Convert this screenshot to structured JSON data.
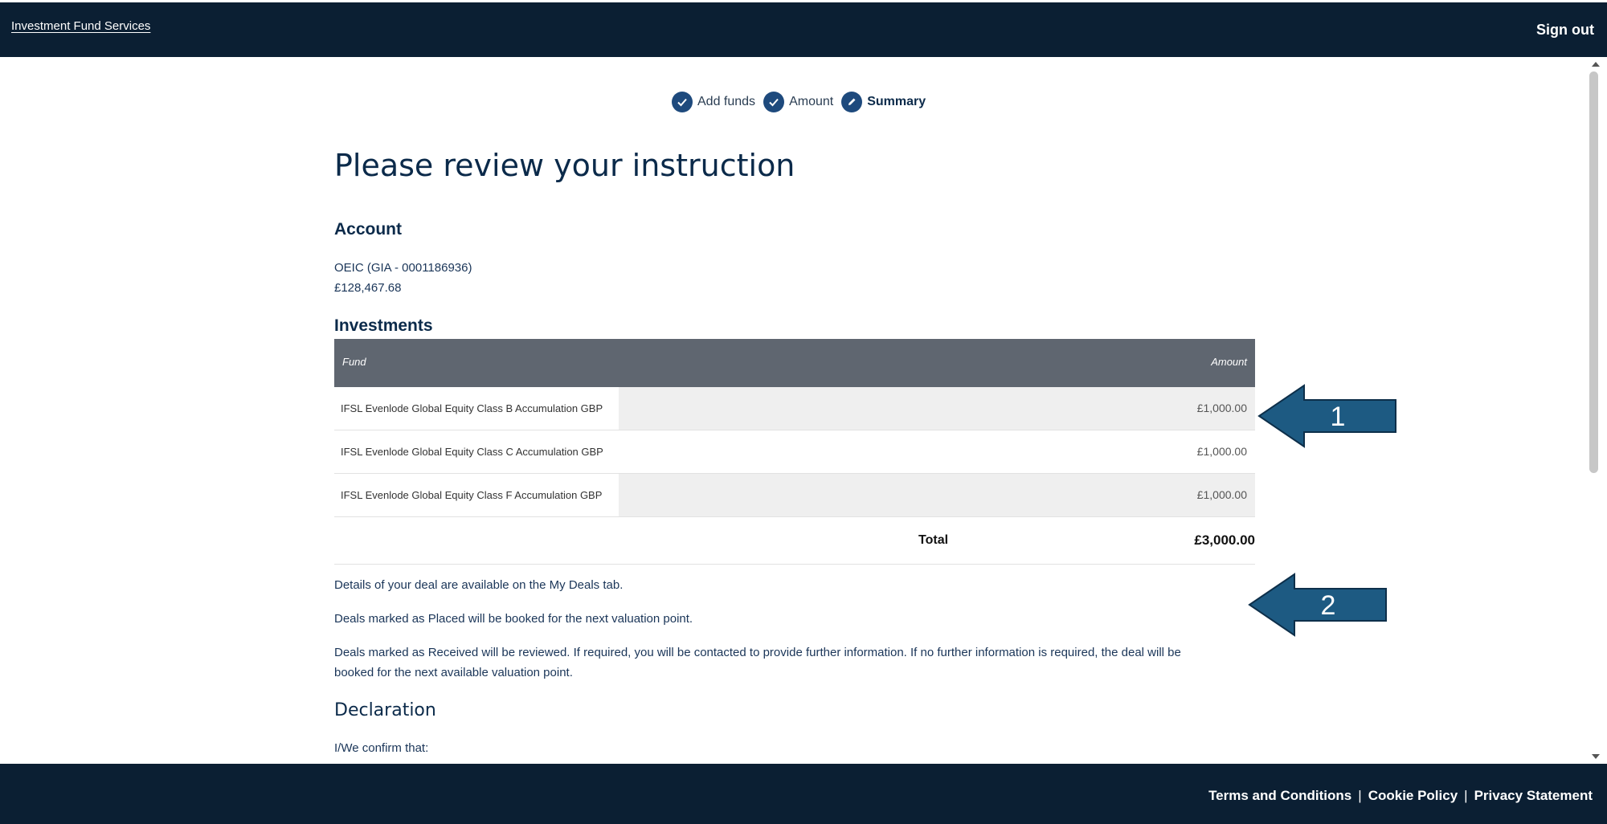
{
  "header": {
    "brand": "Investment Fund Services",
    "sign_out": "Sign out"
  },
  "steps": [
    {
      "label": "Add funds",
      "state": "done",
      "icon": "check-icon"
    },
    {
      "label": "Amount",
      "state": "done",
      "icon": "check-icon"
    },
    {
      "label": "Summary",
      "state": "current",
      "icon": "pencil-icon"
    }
  ],
  "page": {
    "title": "Please review your instruction",
    "account_heading": "Account",
    "account_name": "OEIC (GIA - 0001186936)",
    "account_value": "£128,467.68",
    "investments_heading": "Investments"
  },
  "table": {
    "headers": {
      "fund": "Fund",
      "amount": "Amount"
    },
    "rows": [
      {
        "fund": "IFSL Evenlode Global Equity Class B Accumulation GBP",
        "amount": "£1,000.00"
      },
      {
        "fund": "IFSL Evenlode Global Equity Class C Accumulation GBP",
        "amount": "£1,000.00"
      },
      {
        "fund": "IFSL Evenlode Global Equity Class F Accumulation GBP",
        "amount": "£1,000.00"
      }
    ],
    "total_label": "Total",
    "total_value": "£3,000.00"
  },
  "info": {
    "line1": "Details of your deal are available on the My Deals tab.",
    "line2": "Deals marked as Placed will be booked for the next valuation point.",
    "line3a": "Deals marked as Received will be reviewed. If required, you will be contacted to provide further information. If no further information is required, the deal will be",
    "line3b": "booked for the next available valuation point."
  },
  "declaration": {
    "heading": "Declaration",
    "intro": "I/We confirm that:"
  },
  "annotations": [
    {
      "number": "1",
      "color": "#1d5a82"
    },
    {
      "number": "2",
      "color": "#1d5a82"
    }
  ],
  "footer": {
    "terms": "Terms and Conditions",
    "cookie": "Cookie Policy",
    "privacy": "Privacy Statement",
    "separator": "|"
  },
  "colors": {
    "navy": "#0b1f33",
    "step_blue": "#1e4a7d",
    "table_header": "#5f6670",
    "arrow": "#1d5a82"
  }
}
